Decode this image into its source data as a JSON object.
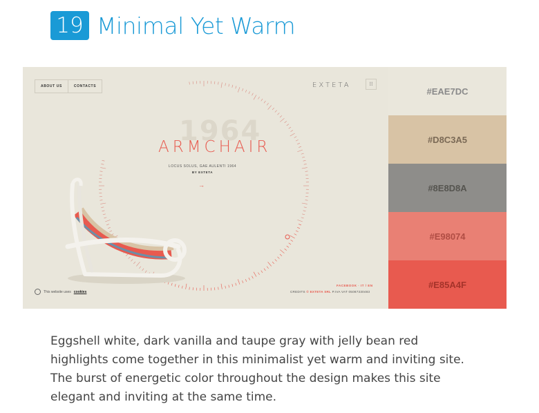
{
  "section": {
    "number": "19",
    "title": "Minimal Yet Warm"
  },
  "site": {
    "nav": [
      "ABOUT US",
      "CONTACTS"
    ],
    "logo": "EXTETA",
    "menu_icon": "grid-menu-icon",
    "year": "1964",
    "product": "ARMCHAIR",
    "subline": "LOCUS SOLUS, GAE AULENTI 1964",
    "byline": "BY EXTETA",
    "arrow": "→",
    "cookie_text": "This website uses",
    "cookie_link": "cookies",
    "social": "FACEBOOK  ·  IT / EN",
    "credits_label": "CREDITS",
    "credits_brand": "© EXTETA SRL",
    "credits_vat": "P.IVA VAT 05087330483"
  },
  "palette": [
    {
      "hex": "#EAE7DC",
      "color": "#eae7dc",
      "text_color": "#8a8a8a"
    },
    {
      "hex": "#D8C3A5",
      "color": "#d8c3a5",
      "text_color": "#7b6a56"
    },
    {
      "hex": "#8E8D8A",
      "color": "#8e8d8a",
      "text_color": "#55544f"
    },
    {
      "hex": "#E98074",
      "color": "#e98074",
      "text_color": "#b04d44"
    },
    {
      "hex": "#E85A4F",
      "color": "#e85a4f",
      "text_color": "#a5332a"
    }
  ],
  "description": "Eggshell white, dark vanilla and taupe gray with jelly bean red highlights come together in this minimalist yet warm and inviting site. The burst of energetic color throughout the design makes this site elegant and inviting at the same time."
}
